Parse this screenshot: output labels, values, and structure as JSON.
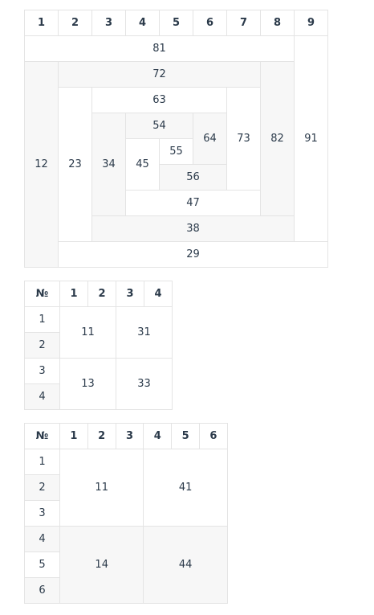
{
  "table1": {
    "header": [
      "1",
      "2",
      "3",
      "4",
      "5",
      "6",
      "7",
      "8",
      "9"
    ],
    "cells": {
      "c81": "81",
      "c91": "91",
      "c12": "12",
      "c72": "72",
      "c82": "82",
      "c23": "23",
      "c63": "63",
      "c73": "73",
      "c34": "34",
      "c54": "54",
      "c64": "64",
      "c45": "45",
      "c55": "55",
      "c56": "56",
      "c47": "47",
      "c38": "38",
      "c29": "29"
    }
  },
  "table2": {
    "header": [
      "№",
      "1",
      "2",
      "3",
      "4"
    ],
    "rows": [
      "1",
      "2",
      "3",
      "4"
    ],
    "cells": {
      "c11": "11",
      "c31": "31",
      "c13": "13",
      "c33": "33"
    }
  },
  "table3": {
    "header": [
      "№",
      "1",
      "2",
      "3",
      "4",
      "5",
      "6"
    ],
    "rows": [
      "1",
      "2",
      "3",
      "4",
      "5",
      "6"
    ],
    "cells": {
      "c11": "11",
      "c41": "41",
      "c14": "14",
      "c44": "44"
    }
  }
}
